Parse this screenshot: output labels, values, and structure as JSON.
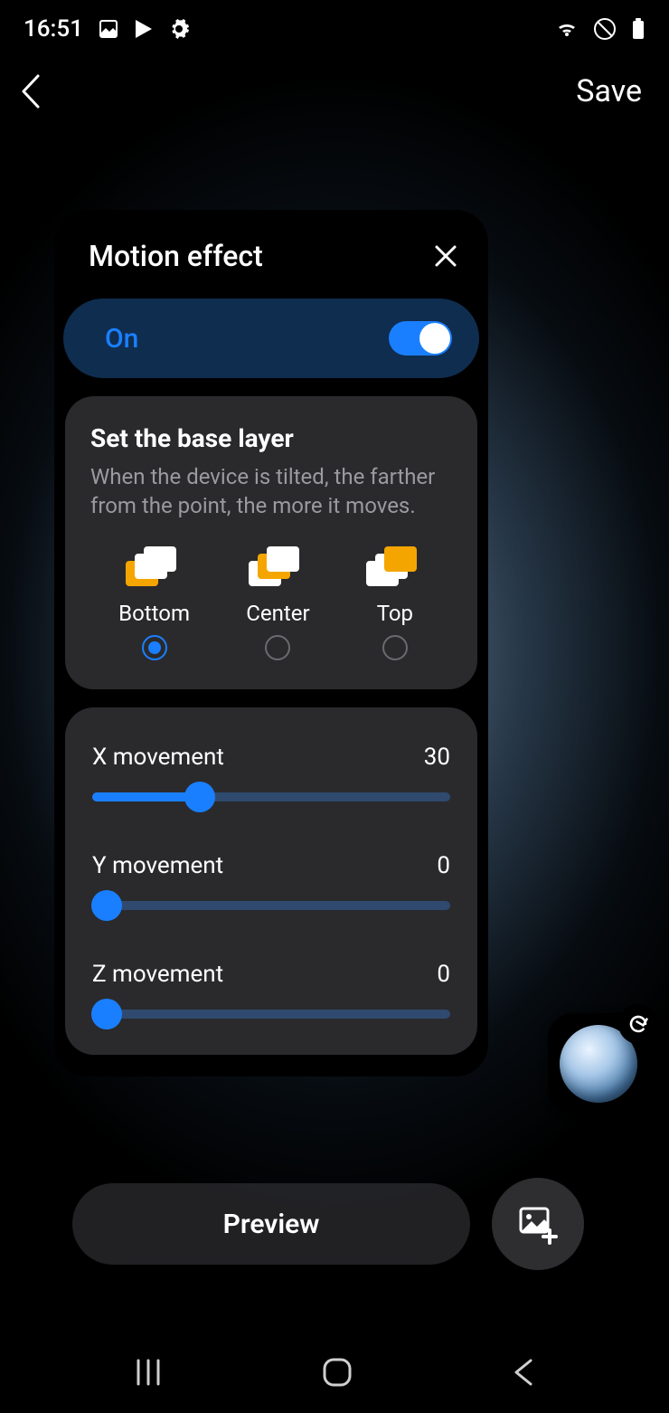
{
  "statusbar": {
    "time": "16:51"
  },
  "appbar": {
    "save_label": "Save"
  },
  "card": {
    "title": "Motion effect",
    "toggle_label": "On",
    "toggle_on": true,
    "base_layer": {
      "heading": "Set the base layer",
      "description": "When the device is tilted, the farther from the point, the more it moves.",
      "options": [
        {
          "label": "Bottom",
          "selected": true,
          "variant": "bottom"
        },
        {
          "label": "Center",
          "selected": false,
          "variant": "center"
        },
        {
          "label": "Top",
          "selected": false,
          "variant": "top"
        }
      ]
    },
    "sliders": [
      {
        "label": "X movement",
        "value": 30,
        "max": 100
      },
      {
        "label": "Y movement",
        "value": 0,
        "max": 100
      },
      {
        "label": "Z movement",
        "value": 0,
        "max": 100
      }
    ]
  },
  "bottom": {
    "preview_label": "Preview"
  }
}
